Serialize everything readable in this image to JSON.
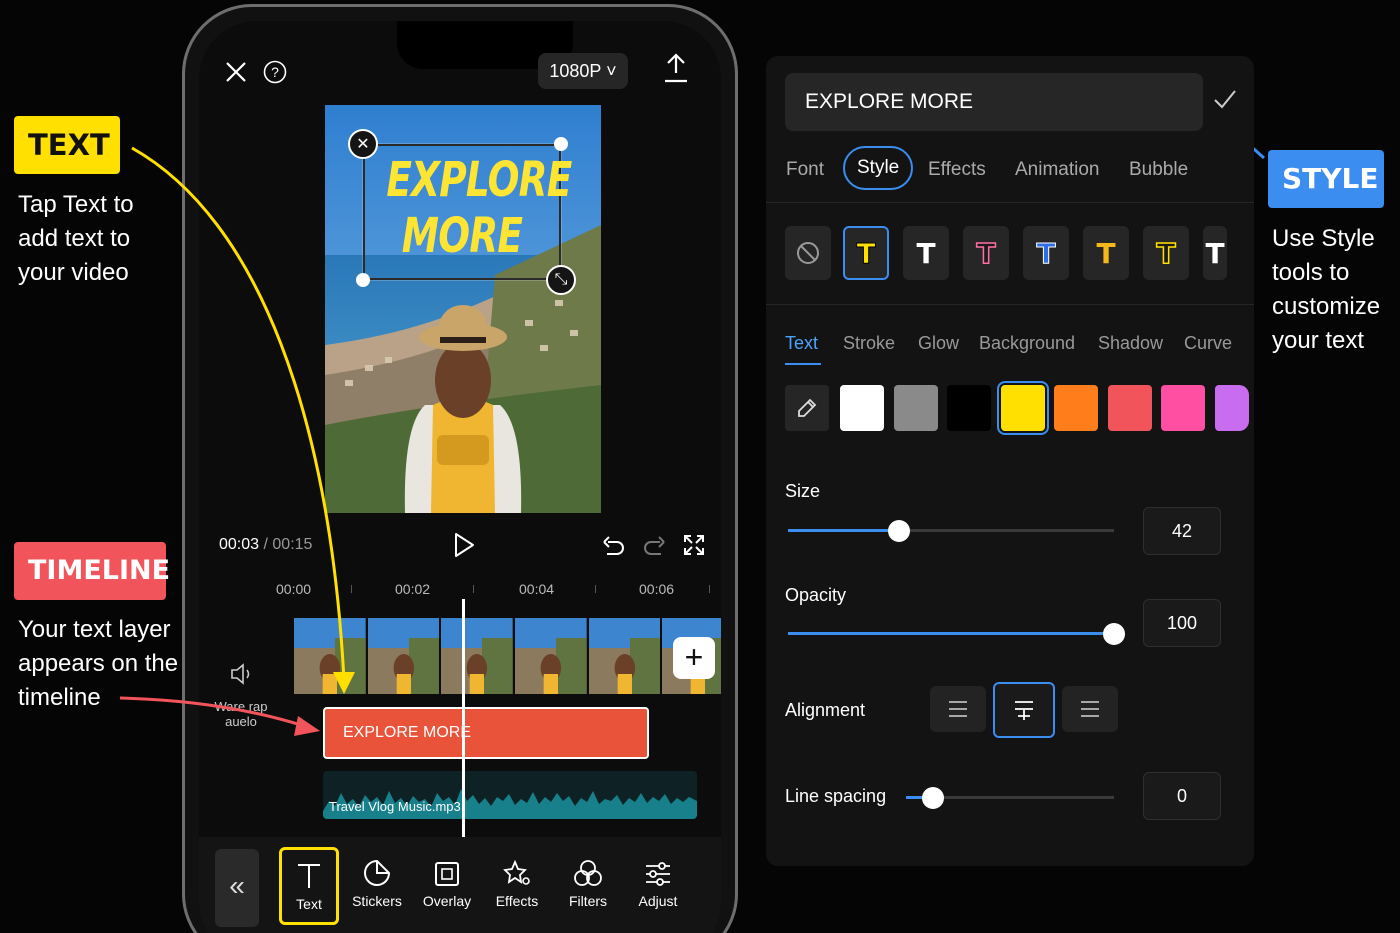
{
  "callouts": {
    "text": {
      "tag": "TEXT",
      "description": "Tap Text to\nadd text to\nyour video"
    },
    "timeline": {
      "tag": "TIMELINE",
      "description": "Your text layer\nappears on the\ntimeline"
    },
    "style": {
      "tag": "STYLE",
      "description": "Use Style\ntools to\ncustomize\nyour text"
    }
  },
  "editor": {
    "resolution": "1080P",
    "overlay_line1": "EXPLORE",
    "overlay_line2": "MORE",
    "current_time": "00:03",
    "duration": "/ 00:15",
    "ruler": [
      "00:00",
      "00:02",
      "00:04",
      "00:06"
    ],
    "mute_label": "Ware rap\nauelo",
    "text_clip": "EXPLORE MORE",
    "music_clip": "Travel Vlog Music.mp3",
    "toolbar": [
      {
        "label": "Text",
        "icon": "text-icon",
        "active": true
      },
      {
        "label": "Stickers",
        "icon": "sticker-icon"
      },
      {
        "label": "Overlay",
        "icon": "overlay-icon"
      },
      {
        "label": "Effects",
        "icon": "effects-icon"
      },
      {
        "label": "Filters",
        "icon": "filters-icon"
      },
      {
        "label": "Adjust",
        "icon": "adjust-icon"
      }
    ]
  },
  "panel": {
    "input_value": "EXPLORE MORE",
    "tabs": [
      "Font",
      "Style",
      "Effects",
      "Animation",
      "Bubble"
    ],
    "active_tab": "Style",
    "subtabs": [
      "Text",
      "Stroke",
      "Glow",
      "Background",
      "Shadow",
      "Curve"
    ],
    "active_subtab": "Text",
    "colors": [
      "#ffffff",
      "#8a8a8a",
      "#000000",
      "#ffe000",
      "#ff7d1a",
      "#f2545b",
      "#ff4fa3",
      "#c86cf0"
    ],
    "selected_color": "#ffe000",
    "size": {
      "label": "Size",
      "value": "42",
      "fraction": 0.34
    },
    "opacity": {
      "label": "Opacity",
      "value": "100",
      "fraction": 1.0
    },
    "alignment": {
      "label": "Alignment",
      "options": [
        "left",
        "center",
        "right"
      ],
      "selected": "center"
    },
    "line_spacing": {
      "label": "Line spacing",
      "value": "0",
      "fraction": 0.13
    }
  },
  "colors": {
    "accent": "#3b8df0",
    "highlight": "#ffe000",
    "clip": "#e8533a",
    "tag_red": "#f2545b"
  }
}
